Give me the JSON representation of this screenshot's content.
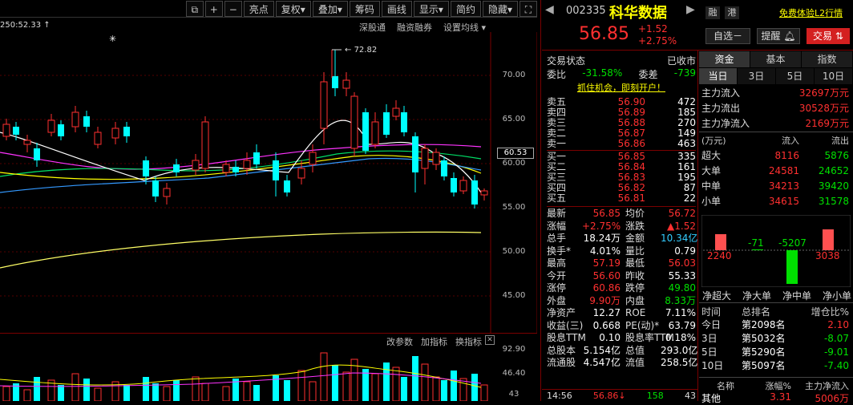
{
  "toolbar": {
    "buttons": [
      "亮点",
      "复权",
      "叠加",
      "筹码",
      "画线",
      "显示",
      "简约",
      "隐藏"
    ],
    "carets": [
      "▾",
      "▾"
    ]
  },
  "chart": {
    "top_info": "250:52.33 ↑",
    "links": [
      "深股通",
      "融资融券",
      "设置均线"
    ],
    "star": "✳",
    "high_label": "72.82",
    "price_ticks": [
      "70.00",
      "65.00",
      "60.00",
      "55.00",
      "50.00",
      "45.00"
    ],
    "current_price_tag": "60.53",
    "vol_links": [
      "改参数",
      "加指标",
      "换指标"
    ],
    "vol_ticks": [
      "92.90",
      "46.40",
      "43"
    ]
  },
  "header": {
    "code": "002335",
    "name": "科华数据",
    "tags": [
      "融",
      "港"
    ],
    "l2_link": "免费体验L2行情",
    "price": "56.85",
    "change": "+1.52",
    "pct": "+2.75%",
    "buttons": [
      "自选－",
      "提醒",
      "交易"
    ]
  },
  "status": {
    "label": "交易状态",
    "value": "已收市",
    "wb_label": "委比",
    "wb": "-31.58%",
    "wc_label": "委差",
    "wc": "-739",
    "ad": "抓住机会，即刻开户！"
  },
  "sells": [
    {
      "label": "卖五",
      "price": "56.90",
      "vol": "472"
    },
    {
      "label": "卖四",
      "price": "56.89",
      "vol": "185"
    },
    {
      "label": "卖三",
      "price": "56.88",
      "vol": "270"
    },
    {
      "label": "卖二",
      "price": "56.87",
      "vol": "149"
    },
    {
      "label": "卖一",
      "price": "56.86",
      "vol": "463"
    }
  ],
  "buys": [
    {
      "label": "买一",
      "price": "56.85",
      "vol": "335"
    },
    {
      "label": "买二",
      "price": "56.84",
      "vol": "161"
    },
    {
      "label": "买三",
      "price": "56.83",
      "vol": "195"
    },
    {
      "label": "买四",
      "price": "56.82",
      "vol": "87"
    },
    {
      "label": "买五",
      "price": "56.81",
      "vol": "22"
    }
  ],
  "stats": [
    {
      "l1": "最新",
      "v1": "56.85",
      "l2": "均价",
      "v2": "56.72"
    },
    {
      "l1": "涨幅",
      "v1": "+2.75%",
      "l2": "涨跌",
      "v2": "▲1.52"
    },
    {
      "l1": "总手",
      "v1": "18.24万",
      "l2": "金额",
      "v2": "10.34亿"
    },
    {
      "l1": "换手*",
      "v1": "4.01%",
      "l2": "量比",
      "v2": "0.79"
    },
    {
      "l1": "最高",
      "v1": "57.19",
      "l2": "最低",
      "v2": "56.03"
    },
    {
      "l1": "今开",
      "v1": "56.60",
      "l2": "昨收",
      "v2": "55.33"
    },
    {
      "l1": "涨停",
      "v1": "60.86",
      "l2": "跌停",
      "v2": "49.80"
    },
    {
      "l1": "外盘",
      "v1": "9.90万",
      "l2": "内盘",
      "v2": "8.33万"
    },
    {
      "l1": "净资产",
      "v1": "12.27",
      "l2": "ROE",
      "v2": "7.11%"
    },
    {
      "l1": "收益(三)",
      "v1": "0.668",
      "l2": "PE(动)*",
      "v2": "63.79"
    },
    {
      "l1": "股息TTM",
      "v1": "0.10",
      "l2": "股息率TTM",
      "v2": "0.18%"
    },
    {
      "l1": "总股本",
      "v1": "5.154亿",
      "l2": "总值",
      "v2": "293.0亿"
    },
    {
      "l1": "流通股",
      "v1": "4.547亿",
      "l2": "流值",
      "v2": "258.5亿"
    }
  ],
  "tick": {
    "time": "14:56",
    "price": "56.86",
    "arrow": "↓",
    "vol": "158",
    "n": "43"
  },
  "fund": {
    "tabs": [
      "资金",
      "基本",
      "指数"
    ],
    "subtabs": [
      "当日",
      "3日",
      "5日",
      "10日"
    ],
    "flows": [
      {
        "label": "主力流入",
        "value": "32697万元"
      },
      {
        "label": "主力流出",
        "value": "30528万元"
      },
      {
        "label": "主力净流入",
        "value": "2169万元"
      }
    ],
    "table_header": [
      "(万元)",
      "流入",
      "流出"
    ],
    "table": [
      {
        "label": "超大",
        "in": "8116",
        "out": "5876"
      },
      {
        "label": "大单",
        "in": "24581",
        "out": "24652"
      },
      {
        "label": "中单",
        "in": "34213",
        "out": "39420"
      },
      {
        "label": "小单",
        "in": "34615",
        "out": "31578"
      }
    ],
    "net_values": [
      "2240",
      "-71",
      "-5207",
      "3038"
    ],
    "net_labels": [
      "净超大",
      "净大单",
      "净中单",
      "净小单"
    ],
    "rank_header": [
      "时间",
      "总排名",
      "增仓比%"
    ],
    "ranks": [
      {
        "t": "今日",
        "r": "第2098名",
        "p": "2.10"
      },
      {
        "t": "3日",
        "r": "第5032名",
        "p": "-8.07"
      },
      {
        "t": "5日",
        "r": "第5290名",
        "p": "-9.01"
      },
      {
        "t": "10日",
        "r": "第5097名",
        "p": "-7.40"
      }
    ],
    "bottom_header": [
      "名称",
      "涨幅%",
      "主力净流入"
    ],
    "bottom_row": {
      "name": "其他",
      "pct": "3.31",
      "net": "5006万"
    }
  }
}
